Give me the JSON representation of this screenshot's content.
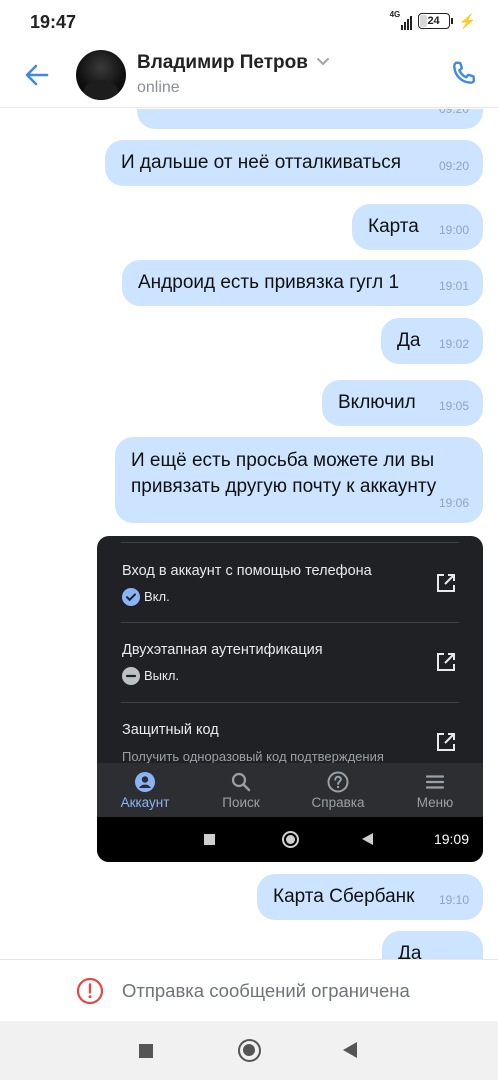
{
  "status_bar": {
    "time": "19:47",
    "network": "4G",
    "battery": "24",
    "battery_fraction": 0.24
  },
  "header": {
    "contact_name": "Владимир Петров",
    "contact_status": "online",
    "icons": [
      "back-arrow-icon",
      "chevron-down-icon",
      "phone-icon"
    ]
  },
  "messages": [
    {
      "text": "",
      "time": "09:20"
    },
    {
      "text": "И дальше от неё отталкиваться",
      "time": "09:20"
    },
    {
      "text": "Карта",
      "time": "19:00"
    },
    {
      "text": "Андроид есть привязка гугл 1",
      "time": "19:01"
    },
    {
      "text": "Да",
      "time": "19:02"
    },
    {
      "text": "Включил",
      "time": "19:05"
    },
    {
      "text_lines": [
        "И ещё есть просьба можете ли вы",
        "привязать другую почту к аккаунту"
      ],
      "time": "19:06"
    },
    {
      "text": "Карта Сбербанк",
      "time": "19:10"
    },
    {
      "text": "Да",
      "time": ""
    }
  ],
  "screenshot": {
    "items": [
      {
        "title": "Вход в аккаунт с помощью телефона",
        "status": "Вкл.",
        "status_icon": "check-circle-icon"
      },
      {
        "title": "Двухэтапная аутентификация",
        "status": "Выкл.",
        "status_icon": "minus-circle-icon"
      },
      {
        "title": "Защитный код",
        "subtitle": "Получить одноразовый код подтверждения"
      }
    ],
    "nav": [
      {
        "label": "Аккаунт",
        "icon": "account-icon",
        "active": true
      },
      {
        "label": "Поиск",
        "icon": "search-icon",
        "active": false
      },
      {
        "label": "Справка",
        "icon": "help-icon",
        "active": false
      },
      {
        "label": "Меню",
        "icon": "menu-icon",
        "active": false
      }
    ],
    "system_time": "19:09"
  },
  "restriction": {
    "text": "Отправка сообщений ограничена",
    "icon": "error-icon"
  },
  "colors": {
    "accent": "#3f8ae0",
    "bubble": "#cce4ff",
    "google_blue": "#8ab4f8",
    "error": "#e64646"
  }
}
